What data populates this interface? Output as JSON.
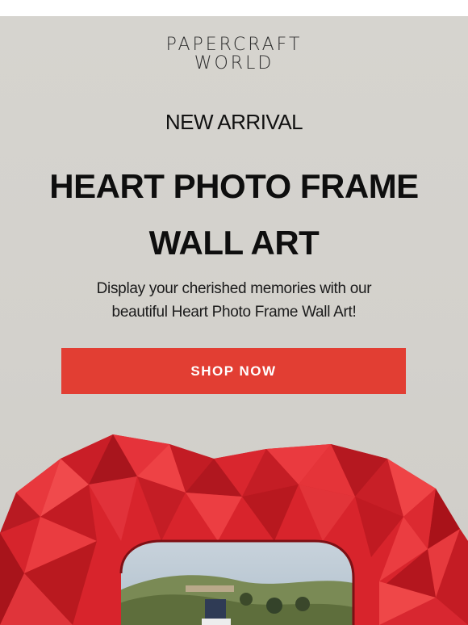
{
  "brand": {
    "line1": "PAPERCRAFT",
    "line2": "WORLD"
  },
  "kicker": "NEW ARRIVAL",
  "headline": {
    "line1": "HEART PHOTO FRAME",
    "line2": "WALL ART"
  },
  "subtext": {
    "line1": "Display your cherished memories with our",
    "line2": "beautiful Heart Photo Frame Wall Art!"
  },
  "cta": {
    "label": "SHOP NOW"
  },
  "colors": {
    "background": "#d5d3ce",
    "cta": "#e23e33",
    "heart": "#d8242c"
  }
}
